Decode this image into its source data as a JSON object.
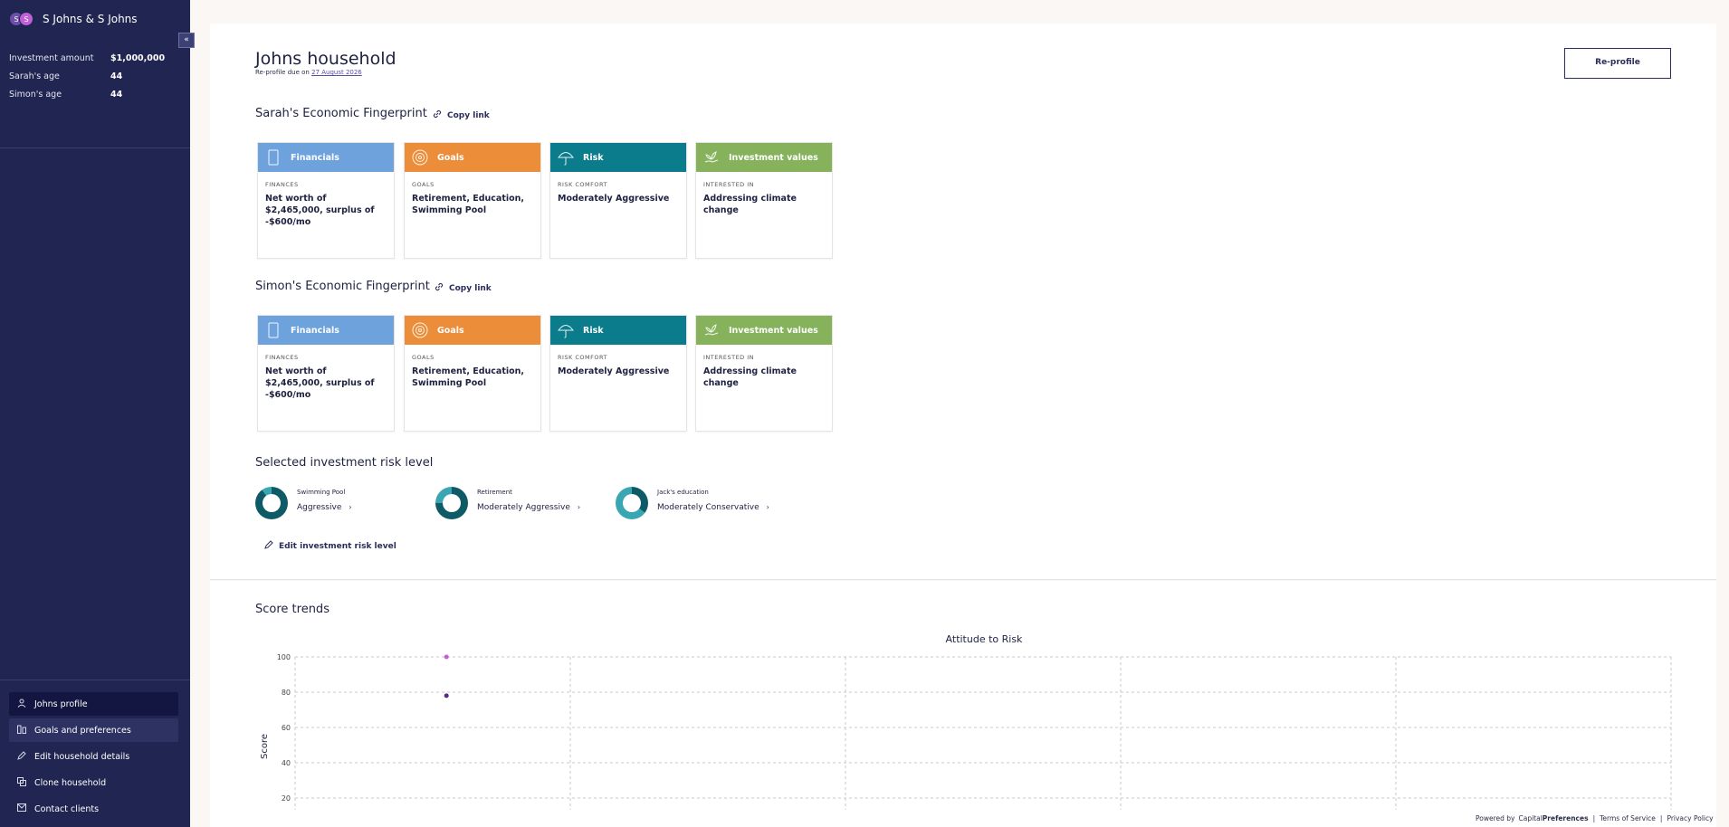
{
  "sidebar": {
    "avatars": [
      "S",
      "S"
    ],
    "household_name": "S Johns & S Johns",
    "collapse_icon": "«",
    "info": [
      {
        "label": "Investment amount",
        "value": "$1,000,000"
      },
      {
        "label": "Sarah's age",
        "value": "44"
      },
      {
        "label": "Simon's age",
        "value": "44"
      }
    ],
    "nav": [
      {
        "label": "Johns profile",
        "icon": "person-icon"
      },
      {
        "label": "Goals and preferences",
        "icon": "goals-icon"
      },
      {
        "label": "Edit household details",
        "icon": "pencil-icon"
      },
      {
        "label": "Clone household",
        "icon": "clone-icon"
      },
      {
        "label": "Contact clients",
        "icon": "mail-icon"
      }
    ]
  },
  "header": {
    "title": "Johns household",
    "subtitle_prefix": "Re-profile due on",
    "due_date": "27 August 2026",
    "reprofile_button": "Re-profile"
  },
  "fingerprints": [
    {
      "title": "Sarah's Economic Fingerprint",
      "copy_link": "Copy link",
      "cards": [
        {
          "head": "Financials",
          "label": "FINANCES",
          "value": "Net worth of $2,465,000, surplus of -$600/mo"
        },
        {
          "head": "Goals",
          "label": "GOALS",
          "value": "Retirement, Education, Swimming Pool"
        },
        {
          "head": "Risk",
          "label": "RISK COMFORT",
          "value": "Moderately Aggressive"
        },
        {
          "head": "Investment values",
          "label": "INTERESTED IN",
          "value": "Addressing climate change"
        }
      ]
    },
    {
      "title": "Simon's Economic Fingerprint",
      "copy_link": "Copy link",
      "cards": [
        {
          "head": "Financials",
          "label": "FINANCES",
          "value": "Net worth of $2,465,000, surplus of -$600/mo"
        },
        {
          "head": "Goals",
          "label": "GOALS",
          "value": "Retirement, Education, Swimming Pool"
        },
        {
          "head": "Risk",
          "label": "RISK COMFORT",
          "value": "Moderately Aggressive"
        },
        {
          "head": "Investment values",
          "label": "INTERESTED IN",
          "value": "Addressing climate change"
        }
      ]
    }
  ],
  "card_colors": {
    "financials": "#6ea2dd",
    "goals": "#ec8d3a",
    "risk": "#0a7c8c",
    "values": "#86b25c"
  },
  "risk_section": {
    "title": "Selected investment risk level",
    "items": [
      {
        "goal": "Swimming Pool",
        "level": "Aggressive",
        "fill_fraction": 0.9
      },
      {
        "goal": "Retirement",
        "level": "Moderately Aggressive",
        "fill_fraction": 0.75
      },
      {
        "goal": "Jack's education",
        "level": "Moderately Conservative",
        "fill_fraction": 0.35
      }
    ],
    "edit_label": "Edit investment risk level"
  },
  "score_trends": {
    "title": "Score trends"
  },
  "chart_data": {
    "type": "scatter",
    "title": "Attitude to Risk",
    "xlabel": "",
    "ylabel": "Score",
    "ylim": [
      0,
      100
    ],
    "y_ticks": [
      100,
      80,
      60,
      40,
      20
    ],
    "grid": true,
    "series": [
      {
        "color": "#c45fd4",
        "points": [
          {
            "x": 1,
            "y": 100
          }
        ]
      },
      {
        "color": "#5b2a84",
        "points": [
          {
            "x": 1,
            "y": 78
          }
        ]
      }
    ]
  },
  "footer": {
    "powered_by": "Powered by",
    "brand_light": "Capital",
    "brand_bold": "Preferences",
    "terms": "Terms of Service",
    "privacy": "Privacy Policy"
  }
}
